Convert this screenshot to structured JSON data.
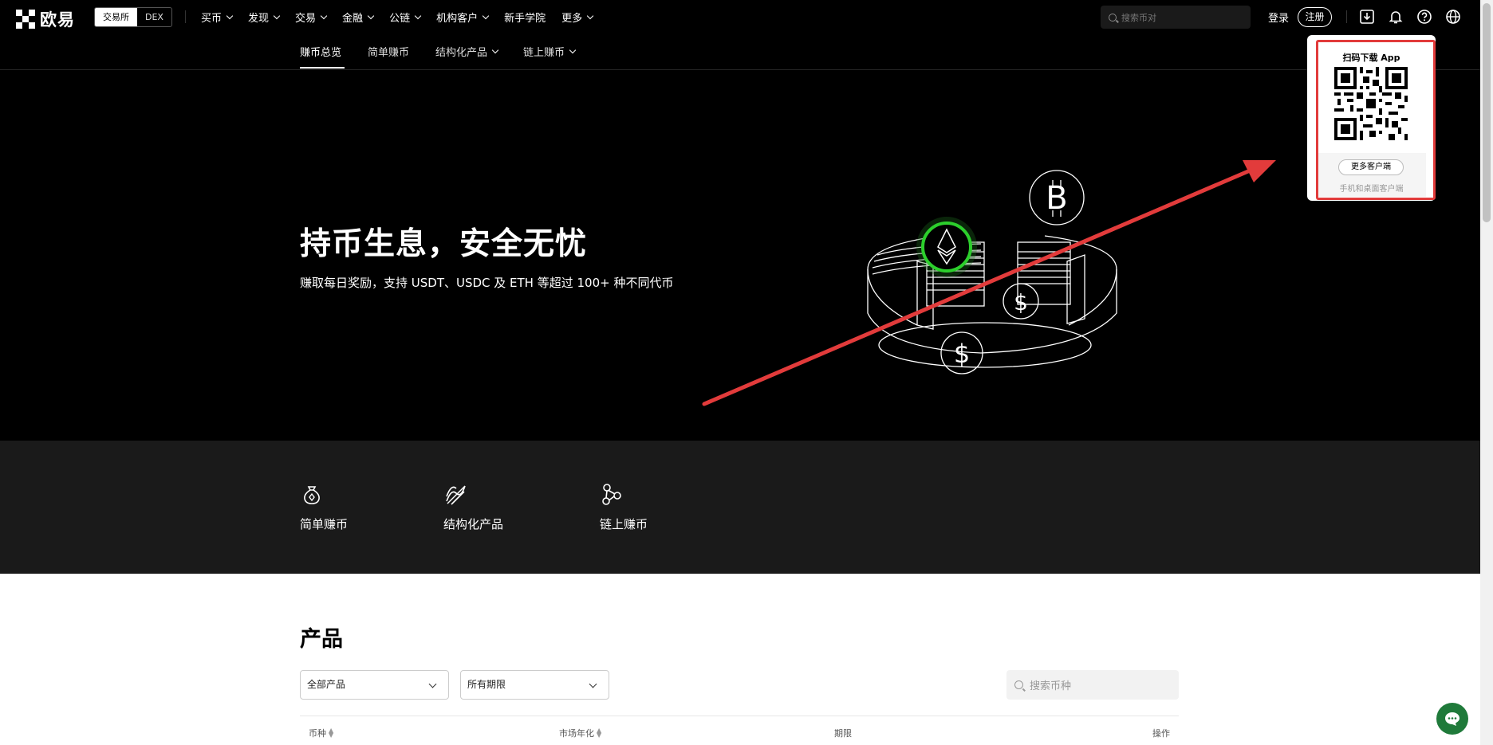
{
  "header": {
    "logo_text": "欧易",
    "toggle": [
      "交易所",
      "DEX"
    ],
    "nav": [
      {
        "label": "买币",
        "has_menu": true
      },
      {
        "label": "发现",
        "has_menu": true
      },
      {
        "label": "交易",
        "has_menu": true
      },
      {
        "label": "金融",
        "has_menu": true
      },
      {
        "label": "公链",
        "has_menu": true
      },
      {
        "label": "机构客户",
        "has_menu": true
      },
      {
        "label": "新手学院",
        "has_menu": false
      },
      {
        "label": "更多",
        "has_menu": true
      }
    ],
    "search_placeholder": "搜索币对",
    "login": "登录",
    "register": "注册",
    "icons": [
      "download-icon",
      "bell-icon",
      "help-icon",
      "globe-icon"
    ]
  },
  "subnav": {
    "items": [
      {
        "label": "赚币总览",
        "active": true,
        "has_menu": false
      },
      {
        "label": "简单赚币",
        "active": false,
        "has_menu": false
      },
      {
        "label": "结构化产品",
        "active": false,
        "has_menu": true
      },
      {
        "label": "链上赚币",
        "active": false,
        "has_menu": true
      }
    ]
  },
  "hero": {
    "title": "持币生息，安全无忧",
    "subtitle": "赚取每日奖励，支持 USDT、USDC 及 ETH 等超过 100+ 种不同代币"
  },
  "categories": [
    {
      "label": "简单赚币",
      "icon": "money-bag-icon"
    },
    {
      "label": "结构化产品",
      "icon": "structured-icon"
    },
    {
      "label": "链上赚币",
      "icon": "chain-nodes-icon"
    }
  ],
  "products": {
    "title": "产品",
    "filter_product": "全部产品",
    "filter_term": "所有期限",
    "search_placeholder": "搜索币种",
    "columns": [
      "币种",
      "市场年化",
      "期限",
      "操作"
    ]
  },
  "qr_popup": {
    "title": "扫码下载 App",
    "button": "更多客户端",
    "subtitle": "手机和桌面客户端"
  },
  "colors": {
    "accent_green": "#2ccf2c",
    "annotation_red": "#e23b3b",
    "chat_green": "#1f7a3a"
  }
}
